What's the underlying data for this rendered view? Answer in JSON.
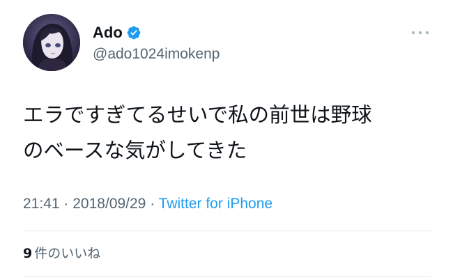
{
  "user": {
    "display_name": "Ado",
    "handle": "@ado1024imokenp",
    "verified": true,
    "avatar": "anime-girl-avatar"
  },
  "tweet": {
    "text_lines": [
      "エラですぎてるせいで私の前世は野球",
      "のベースな気がしてきた"
    ]
  },
  "meta": {
    "time": "21:41",
    "separator": "·",
    "date": "2018/09/29",
    "source": "Twitter for iPhone"
  },
  "likes": {
    "count": "9",
    "label": "件のいいね"
  },
  "icons": {
    "more": "more-horizontal-icon",
    "verified": "verified-badge-icon"
  },
  "colors": {
    "accent": "#1d9bf0",
    "secondary_text": "#536471",
    "divider": "#e6ecf0"
  }
}
